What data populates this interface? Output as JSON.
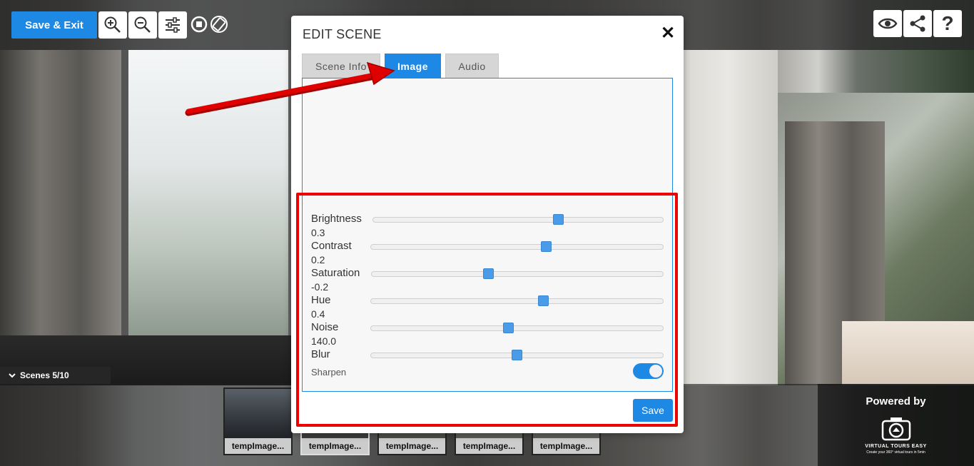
{
  "toolbar": {
    "save_exit_label": "Save & Exit",
    "icons": [
      "zoom-in-icon",
      "zoom-out-icon",
      "sliders-icon",
      "stop-icon",
      "rotate-icon"
    ],
    "right_icons": [
      "eye-icon",
      "share-icon",
      "help-icon"
    ],
    "help_glyph": "?"
  },
  "scenes": {
    "toggle_label": "Scenes 5/10",
    "thumbnails": [
      {
        "caption": "tempImage...",
        "active": false
      },
      {
        "caption": "tempImage...",
        "active": true
      },
      {
        "caption": "tempImage...",
        "active": false
      },
      {
        "caption": "tempImage...",
        "active": false
      },
      {
        "caption": "tempImage...",
        "active": false
      }
    ]
  },
  "powered_by": {
    "label": "Powered by",
    "brand": "VIRTUAL TOURS EASY",
    "tagline": "Create your 360° virtual tours in 5min"
  },
  "modal": {
    "title": "EDIT SCENE",
    "close_glyph": "✕",
    "tabs": [
      {
        "label": "Scene Info",
        "active": false
      },
      {
        "label": "Image",
        "active": true
      },
      {
        "label": "Audio",
        "active": false
      }
    ],
    "controls": [
      {
        "label": "Brightness",
        "value": "0.3",
        "fraction": 0.64
      },
      {
        "label": "Contrast",
        "value": "0.2",
        "fraction": 0.6
      },
      {
        "label": "Saturation",
        "value": "-0.2",
        "fraction": 0.4
      },
      {
        "label": "Hue",
        "value": "0.4",
        "fraction": 0.59
      },
      {
        "label": "Noise",
        "value": "140.0",
        "fraction": 0.47
      },
      {
        "label": "Blur",
        "value": "",
        "fraction": 0.5
      }
    ],
    "sharpen_label": "Sharpen",
    "sharpen_on": true,
    "save_label": "Save"
  },
  "colors": {
    "accent": "#1e88e5",
    "annotation": "#e00000"
  }
}
